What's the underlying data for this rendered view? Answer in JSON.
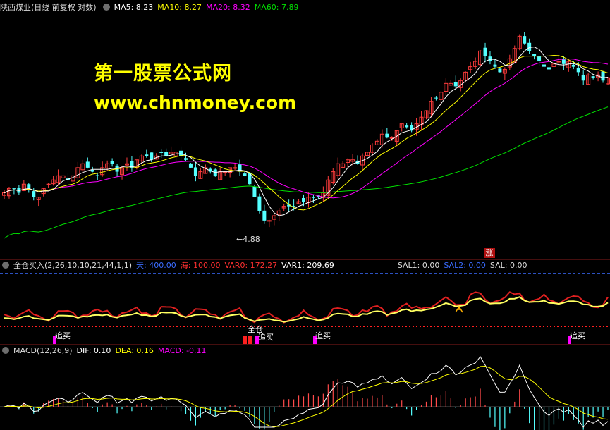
{
  "watermark": {
    "line1": "第一股票公式网",
    "line2": "www.chnmoney.com"
  },
  "main_header": {
    "title": "陕西煤业(日线 前复权 对数)",
    "ma5": "MA5: 8.23",
    "ma10": "MA10: 8.27",
    "ma20": "MA20: 8.32",
    "ma60": "MA60: 7.89"
  },
  "ind_header": {
    "name": "全仓买入(2,26,10,10,21,44,1,1)",
    "tian": "天: 400.00",
    "hai": "海: 100.00",
    "var0": "VAR0: 172.27",
    "var1": "VAR1: 209.69",
    "sal1": "SAL1: 0.00",
    "sal2": "SAL2: 0.00",
    "sal": "SAL: 0.00"
  },
  "macd_header": {
    "name": "MACD(12,26,9)",
    "dif": "DIF: 0.10",
    "dea": "DEA: 0.16",
    "macd": "MACD: -0.11"
  },
  "annotations": {
    "low_label": "4.88",
    "zhang": "涨",
    "zhui1": "追买",
    "quancang": "全仓",
    "zhui2": "追买",
    "zhui3": "追买",
    "zhui4": "追买"
  },
  "colors": {
    "up": "#ff3c3c",
    "down": "#54ffff",
    "ma5": "#ffffff",
    "ma10": "#ffff00",
    "ma20": "#ff00ff",
    "ma60": "#00e000"
  },
  "chart_data": [
    {
      "type": "candlestick",
      "title": "陕西煤业",
      "series_names": [
        "MA5",
        "MA10",
        "MA20",
        "MA60"
      ],
      "approx_close": [
        5.9,
        6.0,
        6.0,
        5.9,
        6.1,
        6.0,
        5.8,
        5.8,
        6.0,
        6.1,
        6.2,
        6.3,
        6.3,
        6.2,
        6.3,
        6.5,
        6.6,
        6.5,
        6.4,
        6.3,
        6.5,
        6.6,
        6.6,
        6.4,
        6.5,
        6.6,
        6.5,
        6.7,
        6.8,
        6.8,
        6.7,
        6.8,
        6.9,
        6.8,
        6.9,
        6.9,
        6.8,
        6.7,
        6.5,
        6.3,
        6.4,
        6.5,
        6.4,
        6.3,
        6.4,
        6.4,
        6.5,
        6.5,
        6.4,
        6.3,
        6.1,
        5.8,
        5.5,
        5.3,
        5.3,
        5.4,
        5.5,
        5.6,
        5.6,
        5.6,
        5.7,
        5.7,
        5.8,
        5.8,
        5.8,
        5.9,
        6.2,
        6.4,
        6.6,
        6.6,
        6.7,
        6.7,
        6.6,
        6.8,
        6.9,
        7.1,
        7.2,
        7.4,
        7.3,
        7.3,
        7.5,
        7.7,
        7.6,
        7.5,
        7.7,
        7.9,
        8.1,
        8.4,
        8.5,
        8.7,
        9.0,
        9.0,
        8.9,
        9.1,
        9.4,
        9.6,
        9.8,
        10.2,
        10.0,
        9.8,
        9.6,
        9.4,
        9.5,
        9.9,
        10.3,
        10.8,
        10.5,
        10.2,
        10.0,
        9.8,
        9.6,
        9.5,
        9.7,
        9.8,
        9.7,
        9.8,
        9.6,
        9.4,
        9.1,
        9.3,
        9.2,
        9.3,
        9.1,
        9.2
      ]
    },
    {
      "type": "line",
      "title": "全仓买入",
      "series_names": [
        "VAR0",
        "VAR1"
      ]
    },
    {
      "type": "bar",
      "title": "MACD",
      "series_names": [
        "DIF",
        "DEA",
        "MACD"
      ]
    }
  ]
}
